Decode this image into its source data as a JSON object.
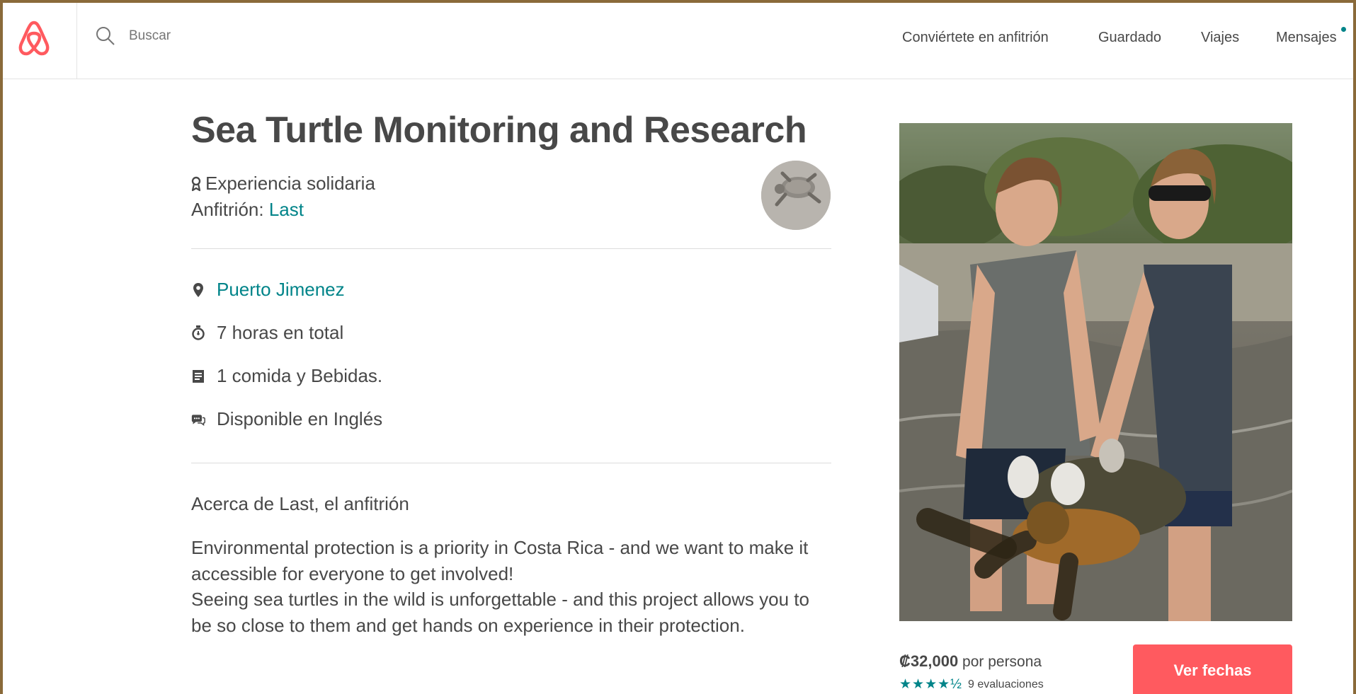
{
  "header": {
    "search_placeholder": "Buscar",
    "nav": [
      "Conviértete en anfitrión",
      "Guardado",
      "Viajes",
      "Mensajes"
    ],
    "accent": "#ff5a5f",
    "notify_color": "#008489"
  },
  "listing": {
    "title": "Sea Turtle Monitoring and Research",
    "category": "Experiencia solidaria",
    "host_prefix": "Anfitrión: ",
    "host_name": "Last",
    "details": [
      {
        "icon": "location-pin-icon",
        "text": "Puerto Jimenez"
      },
      {
        "icon": "clock-icon",
        "text": "7 horas en total"
      },
      {
        "icon": "receipt-icon",
        "text": "1 comida y Bebidas."
      },
      {
        "icon": "chat-icon",
        "text": "Disponible en Inglés"
      }
    ],
    "about_heading": "Acerca de Last, el anfitrión",
    "about_text": "Environmental protection is a priority in Costa Rica - and we want to make it accessible for everyone to get involved!\nSeeing sea turtles in the wild is unforgettable - and this project allows you to be so close to them and get hands on experience in their protection."
  },
  "booking": {
    "price": "₡32,000",
    "price_suffix": " por persona",
    "stars": "★★★★½",
    "rating": 4.5,
    "reviews": "9 evaluaciones",
    "cta": "Ver fechas"
  }
}
